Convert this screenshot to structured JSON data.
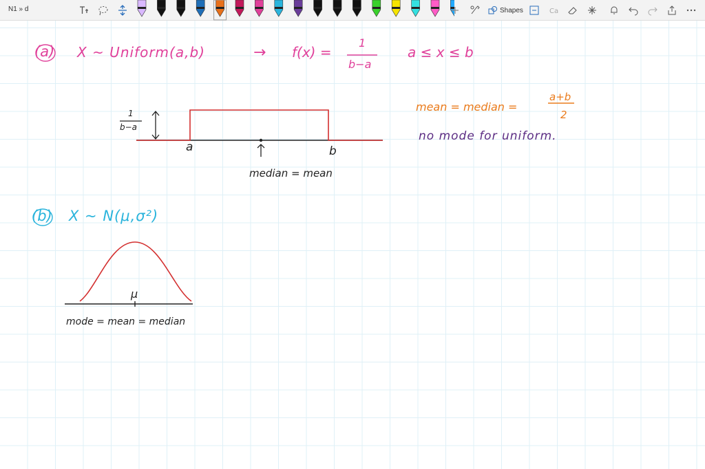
{
  "app": {
    "doc_title": "N1 » d"
  },
  "toolbar": {
    "shapes_label": "Shapes",
    "pens": [
      {
        "color": "#d9b8ff"
      },
      {
        "color": "#111111"
      },
      {
        "color": "#111111"
      },
      {
        "color": "#1f6fb8"
      },
      {
        "color": "#e8701a"
      },
      {
        "color": "#c2185b"
      },
      {
        "color": "#e0409a"
      },
      {
        "color": "#2ab4dc"
      },
      {
        "color": "#6a3d9a"
      },
      {
        "color": "#111111"
      },
      {
        "color": "#111111"
      },
      {
        "color": "#111111"
      },
      {
        "color": "#39d12b"
      },
      {
        "color": "#f5e400"
      },
      {
        "color": "#35e0e0"
      },
      {
        "color": "#ff5cc6"
      },
      {
        "color": "#22aaff"
      }
    ]
  },
  "note": {
    "part_a": {
      "label": "(a)",
      "dist": "X ~ Uniform(a,b)",
      "arrow": "→",
      "pdf_left": "f(x) =",
      "pdf_num": "1",
      "pdf_den": "b−a",
      "range": "a ≤ x ≤ b",
      "axis_height_num": "1",
      "axis_height_den": "b−a",
      "tick_a": "a",
      "tick_b": "b",
      "center_label": "median = mean",
      "mean_text": "mean = median =",
      "mean_num": "a+b",
      "mean_den": "2",
      "mode_text": "no mode for uniform."
    },
    "part_b": {
      "label": "(b)",
      "dist": "X ~ N(μ,σ²)",
      "mu": "μ",
      "summary": "mode = mean = median"
    }
  },
  "colors": {
    "part_a": "#e0409a",
    "part_b": "#2ab4dc",
    "curve": "#d32f2f",
    "mean_note": "#ea7b1c",
    "mode_note": "#5b2c83"
  }
}
